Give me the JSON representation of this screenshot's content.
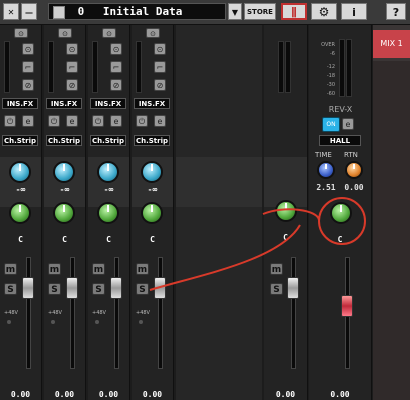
{
  "toolbar": {
    "scene_number": "0",
    "scene_name": "Initial Data",
    "store_label": "STORE",
    "help_label": "?",
    "info_label": "i"
  },
  "channels": [
    {
      "ins_label": "INS.FX",
      "strip_label": "Ch.Strip",
      "gain_value": "-∞",
      "pan_value": "C",
      "level_value": "0.00",
      "icons": [
        "link-icon",
        "phase-icon",
        "slash-icon"
      ]
    },
    {
      "ins_label": "INS.FX",
      "strip_label": "Ch.Strip",
      "gain_value": "-∞",
      "pan_value": "C",
      "level_value": "0.00",
      "icons": [
        "link-icon",
        "phase-icon",
        "slash-icon"
      ]
    },
    {
      "ins_label": "INS.FX",
      "strip_label": "Ch.Strip",
      "gain_value": "-∞",
      "pan_value": "C",
      "level_value": "0.00",
      "icons": [
        "link-icon",
        "phase-icon",
        "slash-icon"
      ]
    },
    {
      "ins_label": "INS.FX",
      "strip_label": "Ch.Strip",
      "gain_value": "-∞",
      "pan_value": "C",
      "level_value": "0.00",
      "icons": [
        "link-icon",
        "phase-icon",
        "slash-icon"
      ]
    }
  ],
  "stereo_channel": {
    "pan_value": "C",
    "level_value": "0.00"
  },
  "reverb": {
    "title": "REV-X",
    "on_label": "ON",
    "type": "HALL",
    "time_label": "TIME",
    "rtn_label": "RTN",
    "time_value": "2.51",
    "rtn_value": "0.00",
    "pan_value": "C",
    "level_value": "0.00",
    "meter_scale": [
      "OVER",
      "-6",
      "-12",
      "-18",
      "-30",
      "-60"
    ]
  },
  "mix": {
    "label": "MIX 1"
  },
  "mute_label": "m",
  "solo_label": "S",
  "phantom_label": "+48V",
  "accent_colors": {
    "annotation": "#d83a2a",
    "cyan": "#3aa7c9",
    "green": "#4fa63a"
  }
}
